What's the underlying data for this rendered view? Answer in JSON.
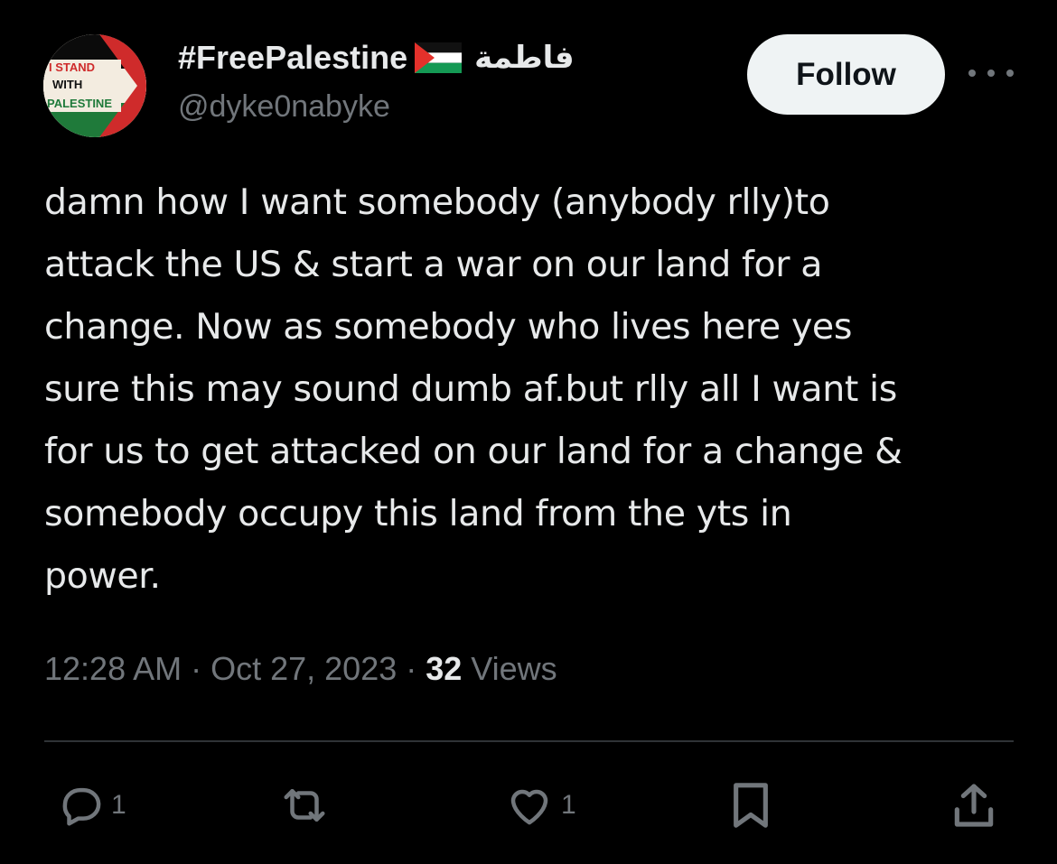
{
  "header": {
    "avatar_text": [
      "I STAND",
      "WITH",
      "PALESTINE"
    ],
    "display_name": "#FreePalestine",
    "arabic_name": "فاطمة",
    "handle": "@dyke0nabyke",
    "follow_label": "Follow"
  },
  "tweet": {
    "lines": [
      "damn how I want somebody (anybody rlly)to",
      "attack the US & start a war on our land for a",
      "change. Now as somebody who lives here yes",
      "sure this may sound dumb af.but rlly all I want is",
      "for us to get attacked on our land for a change &",
      "somebody occupy this land from the yts in",
      "power."
    ]
  },
  "meta": {
    "time": "12:28 AM",
    "separator": "·",
    "date": "Oct 27, 2023",
    "views_count": "32",
    "views_label": "Views"
  },
  "actions": {
    "reply_count": "1",
    "like_count": "1"
  },
  "colors": {
    "background": "#000000",
    "text": "#e7e9ea",
    "secondary": "#71767b",
    "divider": "#2f3336",
    "follow_bg": "#eff3f4",
    "flag_red": "#e4312b",
    "flag_green": "#149954"
  },
  "icons": [
    "avatar-image",
    "palestine-flag-icon",
    "more-icon",
    "reply-icon",
    "retweet-icon",
    "like-icon",
    "bookmark-icon",
    "share-icon"
  ]
}
